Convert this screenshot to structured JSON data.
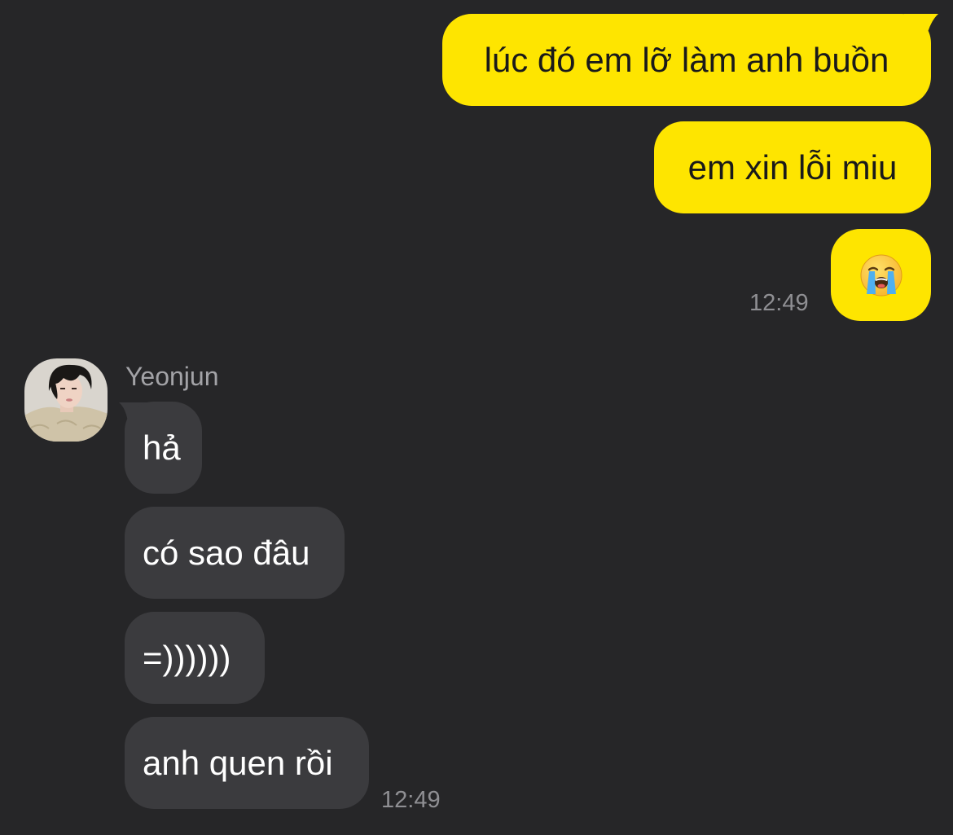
{
  "colors": {
    "background": "#262628",
    "outgoing_bubble": "#FEE500",
    "incoming_bubble": "#3b3b3e",
    "timestamp": "#8f8f93",
    "sender_name": "#a3a3a7"
  },
  "outgoing": {
    "messages": [
      {
        "text": "lúc đó em lỡ làm anh buồn"
      },
      {
        "text": "em xin lỗi miu"
      },
      {
        "emoji": "loudly-crying-face-emoji"
      }
    ],
    "time": "12:49"
  },
  "incoming": {
    "sender": "Yeonjun",
    "avatar_icon": "profile-photo-avatar",
    "messages": [
      {
        "text": "hả"
      },
      {
        "text": "có sao đâu"
      },
      {
        "text": "=))))))"
      },
      {
        "text": "anh quen rồi"
      }
    ],
    "time": "12:49"
  }
}
